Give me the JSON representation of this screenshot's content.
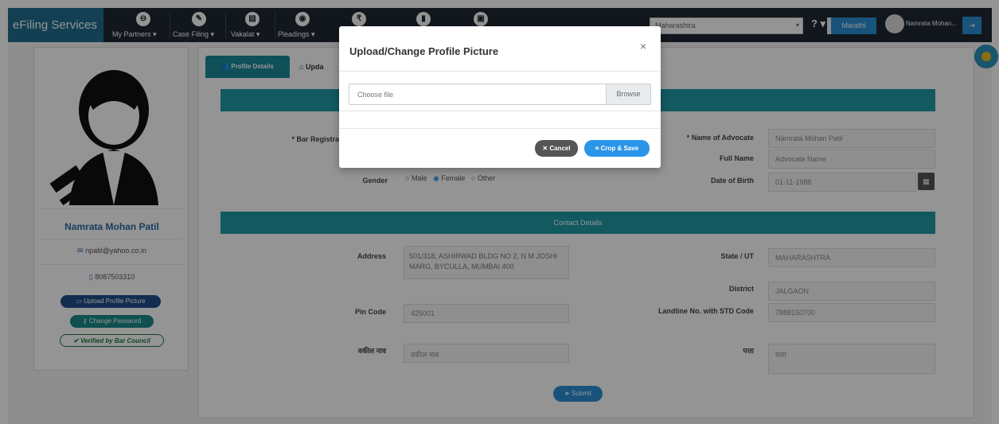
{
  "navbar": {
    "brand": "eFiling Services",
    "items": [
      {
        "label": "My Partners ▾",
        "icon": "handshake-icon"
      },
      {
        "label": "Case Filing ▾",
        "icon": "pencil-icon"
      },
      {
        "label": "Vakalat ▾",
        "icon": "document-icon"
      },
      {
        "label": "Pleadings ▾",
        "icon": "chat-icon"
      },
      {
        "label": "",
        "icon": "rupee-icon"
      },
      {
        "label": "",
        "icon": "file-icon"
      },
      {
        "label": "",
        "icon": "briefcase-icon"
      }
    ],
    "state_select": "Maharashtra",
    "help": "? ▾",
    "language": "Marathi",
    "user": "Namrata Mohan...",
    "logout": "⇥"
  },
  "sidebar": {
    "name": "Namrata Mohan Patil",
    "email": "npatil@yahoo.co.in",
    "phone": "8087503310",
    "upload_btn": "Upload Profile Picture",
    "password_btn": "Change Password",
    "verified": "Verified by Bar Council"
  },
  "tabs": {
    "active": "Profile Details",
    "second": "Upda"
  },
  "form": {
    "bar_reg_label": "* Bar Registrat",
    "advocate_label": "* Name of Advocate",
    "advocate_value": "Namrata Mohan Patil",
    "full_name_label": "Full Name",
    "full_name_value": "Advocate Name",
    "gender_label": "Gender",
    "gender_options": [
      "Male",
      "Female",
      "Other"
    ],
    "gender_selected": "Female",
    "dob_label": "Date of Birth",
    "dob_value": "01-11-1988",
    "contact_header": "Contact Details",
    "address_label": "Address",
    "address_value": "501/318, ASHIRWAD BLDG NO 2, N M JOSHI MARG, BYCULLA, MUMBAI 400",
    "state_label": "State / UT",
    "state_value": "MAHARASHTRA",
    "district_label": "District",
    "district_value": "JALGAON",
    "pin_label": "Pin Code",
    "pin_value": "425001",
    "landline_label": "Landline No. with STD Code",
    "landline_value": "7888150700",
    "vakil_label": "वकील नाव",
    "vakil_value": "वकील नाव",
    "patta_label": "पत्ता",
    "patta_value": "पत्ता",
    "submit": "Submit"
  },
  "modal": {
    "title": "Upload/Change Profile Picture",
    "close": "×",
    "file_placeholder": "Choose file",
    "browse": "Browse",
    "cancel": "Cancel",
    "crop_save": "Crop & Save"
  },
  "colors": {
    "navbar": "#1e2832",
    "brand": "#1f6f8e",
    "teal": "#1f9aa6",
    "accent_blue": "#2b95e8"
  }
}
